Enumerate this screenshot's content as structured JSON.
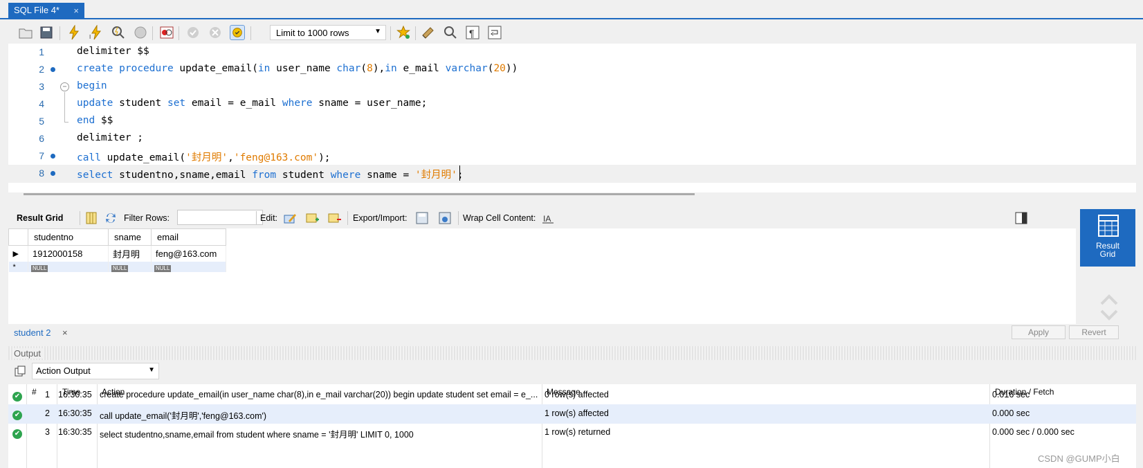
{
  "tab": {
    "title": "SQL File 4*",
    "close": "×"
  },
  "toolbar": {
    "limit": "Limit to 1000 rows",
    "icons": [
      "open-folder-icon",
      "save-icon",
      "execute-icon",
      "execute-current-icon",
      "explain-icon",
      "stop-icon",
      "toggle-error-icon",
      "commit-icon",
      "rollback-icon",
      "autocommit-icon",
      "bookmark-icon",
      "beautify-icon",
      "find-icon",
      "invisible-chars-icon",
      "wrap-icon"
    ]
  },
  "editor": {
    "lines": [
      {
        "n": "1",
        "dot": false,
        "fold": "",
        "tokens": [
          [
            "",
            "delimiter $$"
          ]
        ]
      },
      {
        "n": "2",
        "dot": true,
        "fold": "",
        "tokens": [
          [
            "kw",
            "create"
          ],
          [
            "",
            " "
          ],
          [
            "kw",
            "procedure"
          ],
          [
            "",
            " update_email("
          ],
          [
            "kw",
            "in"
          ],
          [
            "",
            " user_name "
          ],
          [
            "kw",
            "char"
          ],
          [
            "",
            "("
          ],
          [
            "num",
            "8"
          ],
          [
            "",
            "),"
          ],
          [
            "kw",
            "in"
          ],
          [
            "",
            " e_mail "
          ],
          [
            "kw",
            "varchar"
          ],
          [
            "",
            "("
          ],
          [
            "num",
            "20"
          ],
          [
            "",
            "))"
          ]
        ]
      },
      {
        "n": "3",
        "dot": false,
        "fold": "⊖",
        "tokens": [
          [
            "kw",
            "begin"
          ]
        ]
      },
      {
        "n": "4",
        "dot": false,
        "fold": "",
        "tokens": [
          [
            "kw",
            "update"
          ],
          [
            "",
            " student "
          ],
          [
            "kw",
            "set"
          ],
          [
            "",
            " email = e_mail "
          ],
          [
            "kw",
            "where"
          ],
          [
            "",
            " sname = user_name;"
          ]
        ]
      },
      {
        "n": "5",
        "dot": false,
        "fold": "",
        "tokens": [
          [
            "kw",
            "end"
          ],
          [
            "",
            " $$"
          ]
        ]
      },
      {
        "n": "6",
        "dot": false,
        "fold": "",
        "tokens": [
          [
            "",
            "delimiter ;"
          ]
        ]
      },
      {
        "n": "7",
        "dot": true,
        "fold": "",
        "tokens": [
          [
            "kw",
            "call"
          ],
          [
            "",
            " update_email("
          ],
          [
            "str",
            "'封月明'"
          ],
          [
            "",
            ","
          ],
          [
            "str",
            "'feng@163.com'"
          ],
          [
            "",
            ");"
          ]
        ]
      },
      {
        "n": "8",
        "dot": true,
        "fold": "",
        "tokens": [
          [
            "kw",
            "select"
          ],
          [
            "",
            " studentno,sname,email "
          ],
          [
            "kw",
            "from"
          ],
          [
            "",
            " student "
          ],
          [
            "kw",
            "where"
          ],
          [
            "",
            " sname = "
          ],
          [
            "str",
            "'封月明'"
          ],
          [
            "",
            ";"
          ]
        ]
      }
    ]
  },
  "result_toolbar": {
    "result_grid": "Result Grid",
    "filter_rows": "Filter Rows:",
    "edit": "Edit:",
    "export_import": "Export/Import:",
    "wrap_cell": "Wrap Cell Content:"
  },
  "grid": {
    "columns": [
      "studentno",
      "sname",
      "email"
    ],
    "row": [
      "1912000158",
      "封月明",
      "feng@163.com"
    ],
    "null_label": "NULL"
  },
  "side_panel": {
    "result_grid_line1": "Result",
    "result_grid_line2": "Grid"
  },
  "student_tab": {
    "title": "student 2",
    "close": "×",
    "apply": "Apply",
    "revert": "Revert"
  },
  "output": {
    "label": "Output",
    "select": "Action Output",
    "headers": {
      "num": "#",
      "time": "Time",
      "action": "Action",
      "message": "Message",
      "duration": "Duration / Fetch"
    },
    "rows": [
      {
        "num": "1",
        "time": "16:30:35",
        "action": "create procedure update_email(in user_name char(8),in e_mail varchar(20)) begin update student set email = e_...",
        "message": "0 row(s) affected",
        "duration": "0.016 sec"
      },
      {
        "num": "2",
        "time": "16:30:35",
        "action": "call update_email('封月明','feng@163.com')",
        "message": "1 row(s) affected",
        "duration": "0.000 sec"
      },
      {
        "num": "3",
        "time": "16:30:35",
        "action": "select studentno,sname,email from student where sname = '封月明' LIMIT 0, 1000",
        "message": "1 row(s) returned",
        "duration": "0.000 sec / 0.000 sec"
      }
    ]
  },
  "watermark": "CSDN @GUMP小白"
}
